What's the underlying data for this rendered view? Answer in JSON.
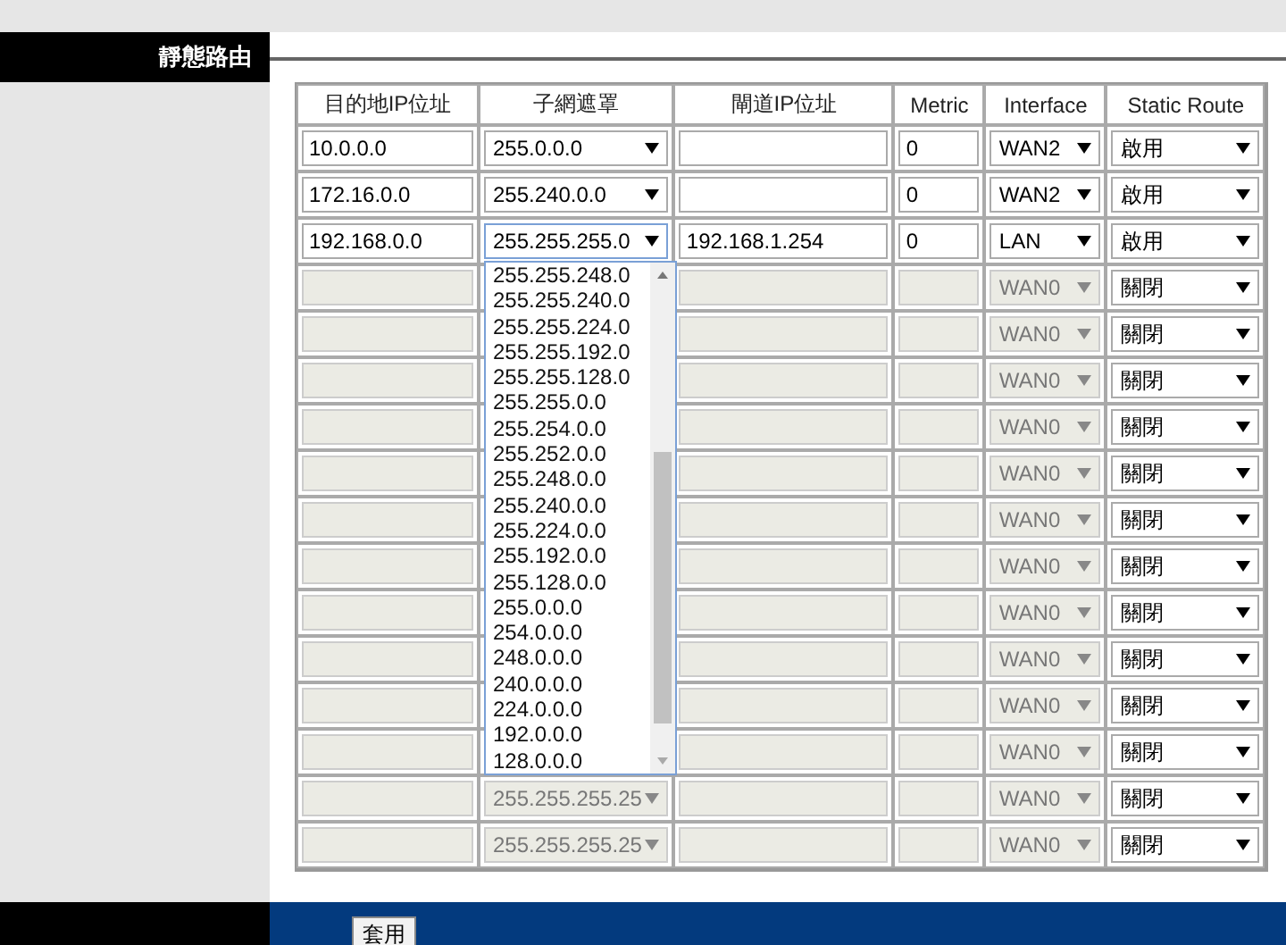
{
  "section": {
    "title": "靜態路由"
  },
  "table": {
    "columns": [
      "目的地IP位址",
      "子網遮罩",
      "閘道IP位址",
      "Metric",
      "Interface",
      "Static Route"
    ],
    "rows": [
      {
        "disabled": false,
        "destination": "10.0.0.0",
        "mask": "255.0.0.0",
        "gateway": "",
        "metric": "0",
        "interface": "WAN2",
        "route": "啟用"
      },
      {
        "disabled": false,
        "destination": "172.16.0.0",
        "mask": "255.240.0.0",
        "gateway": "",
        "metric": "0",
        "interface": "WAN2",
        "route": "啟用"
      },
      {
        "disabled": false,
        "destination": "192.168.0.0",
        "mask": "255.255.255.0",
        "gateway": "192.168.1.254",
        "metric": "0",
        "interface": "LAN",
        "route": "啟用",
        "mask_open": true
      },
      {
        "disabled": true,
        "interface": "WAN0",
        "route": "關閉"
      },
      {
        "disabled": true,
        "interface": "WAN0",
        "route": "關閉"
      },
      {
        "disabled": true,
        "interface": "WAN0",
        "route": "關閉"
      },
      {
        "disabled": true,
        "interface": "WAN0",
        "route": "關閉"
      },
      {
        "disabled": true,
        "interface": "WAN0",
        "route": "關閉"
      },
      {
        "disabled": true,
        "interface": "WAN0",
        "route": "關閉"
      },
      {
        "disabled": true,
        "interface": "WAN0",
        "route": "關閉"
      },
      {
        "disabled": true,
        "interface": "WAN0",
        "route": "關閉"
      },
      {
        "disabled": true,
        "interface": "WAN0",
        "route": "關閉"
      },
      {
        "disabled": true,
        "interface": "WAN0",
        "route": "關閉"
      },
      {
        "disabled": true,
        "interface": "WAN0",
        "route": "關閉"
      },
      {
        "disabled": true,
        "mask": "255.255.255.25",
        "interface": "WAN0",
        "route": "關閉"
      },
      {
        "disabled": true,
        "mask": "255.255.255.25",
        "interface": "WAN0",
        "route": "關閉"
      }
    ]
  },
  "mask_dropdown": {
    "options": [
      "255.255.248.0",
      "255.255.240.0",
      "255.255.224.0",
      "255.255.192.0",
      "255.255.128.0",
      "255.255.0.0",
      "255.254.0.0",
      "255.252.0.0",
      "255.248.0.0",
      "255.240.0.0",
      "255.224.0.0",
      "255.192.0.0",
      "255.128.0.0",
      "255.0.0.0",
      "254.0.0.0",
      "248.0.0.0",
      "240.0.0.0",
      "224.0.0.0",
      "192.0.0.0",
      "128.0.0.0"
    ]
  },
  "apply_button": "套用"
}
